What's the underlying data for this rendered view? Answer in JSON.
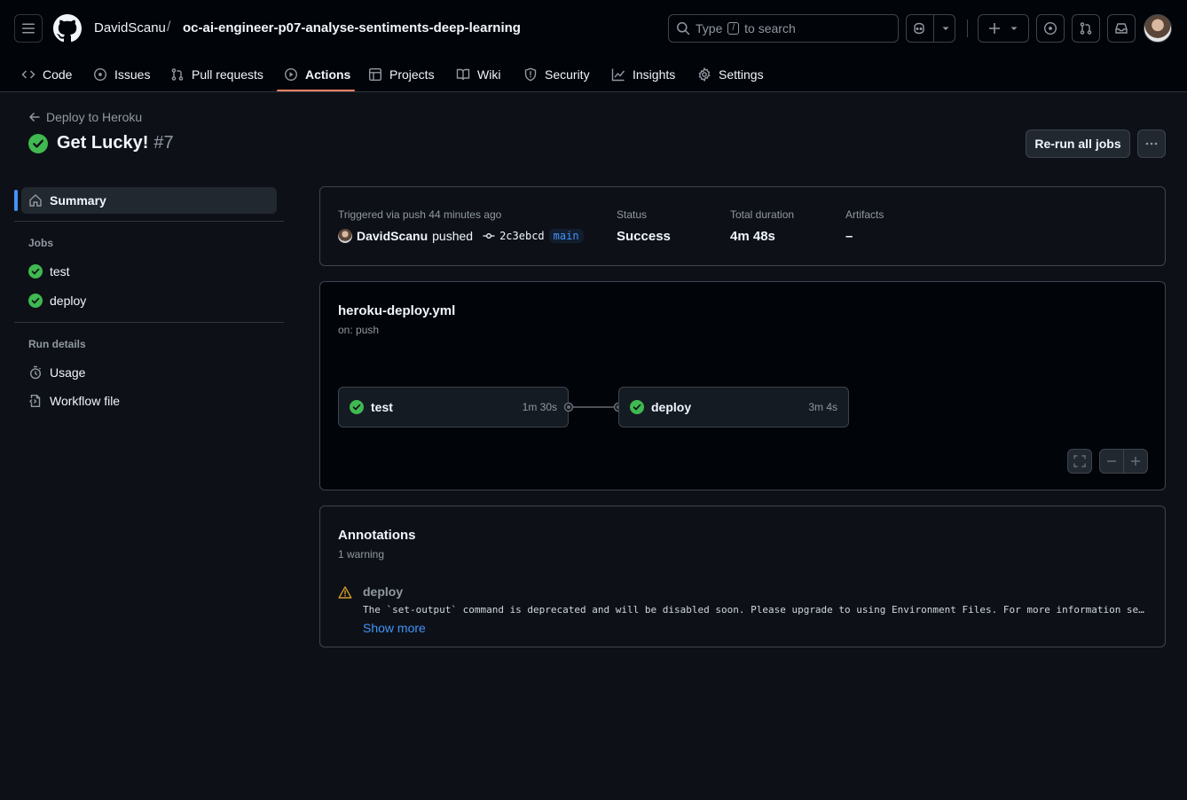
{
  "header": {
    "owner": "DavidScanu",
    "separator": "/",
    "repo": "oc-ai-engineer-p07-analyse-sentiments-deep-learning",
    "search": {
      "prefix": "Type",
      "key": "/",
      "suffix": "to search"
    }
  },
  "nav": {
    "tabs": [
      {
        "label": "Code",
        "icon": "code-icon"
      },
      {
        "label": "Issues",
        "icon": "issue-icon"
      },
      {
        "label": "Pull requests",
        "icon": "pull-request-icon"
      },
      {
        "label": "Actions",
        "icon": "play-icon",
        "active": true
      },
      {
        "label": "Projects",
        "icon": "table-icon"
      },
      {
        "label": "Wiki",
        "icon": "book-icon"
      },
      {
        "label": "Security",
        "icon": "shield-icon"
      },
      {
        "label": "Insights",
        "icon": "graph-icon"
      },
      {
        "label": "Settings",
        "icon": "gear-icon"
      }
    ]
  },
  "run": {
    "back_label": "Deploy to Heroku",
    "title": "Get Lucky!",
    "number": "#7",
    "rerun_label": "Re-run all jobs"
  },
  "sidebar": {
    "summary_label": "Summary",
    "jobs_heading": "Jobs",
    "jobs": [
      "test",
      "deploy"
    ],
    "run_details_heading": "Run details",
    "usage_label": "Usage",
    "workflow_file_label": "Workflow file"
  },
  "summary": {
    "trigger_text": "Triggered via push 44 minutes ago",
    "actor": "DavidScanu",
    "action": "pushed",
    "commit": "2c3ebcd",
    "branch": "main",
    "status_label": "Status",
    "status_value": "Success",
    "duration_label": "Total duration",
    "duration_value": "4m 48s",
    "artifacts_label": "Artifacts",
    "artifacts_value": "–"
  },
  "workflow": {
    "file": "heroku-deploy.yml",
    "trigger": "on: push",
    "jobs": [
      {
        "name": "test",
        "duration": "1m 30s"
      },
      {
        "name": "deploy",
        "duration": "3m 4s"
      }
    ]
  },
  "annotations": {
    "title": "Annotations",
    "count": "1 warning",
    "items": [
      {
        "job": "deploy",
        "message": "The `set-output` command is deprecated and will be disabled soon. Please upgrade to using Environment Files. For more information see…",
        "more_label": "Show more"
      }
    ]
  },
  "colors": {
    "success": "#3fb950",
    "warning": "#d29922",
    "link": "#4493f8",
    "active_tab": "#f78166"
  }
}
